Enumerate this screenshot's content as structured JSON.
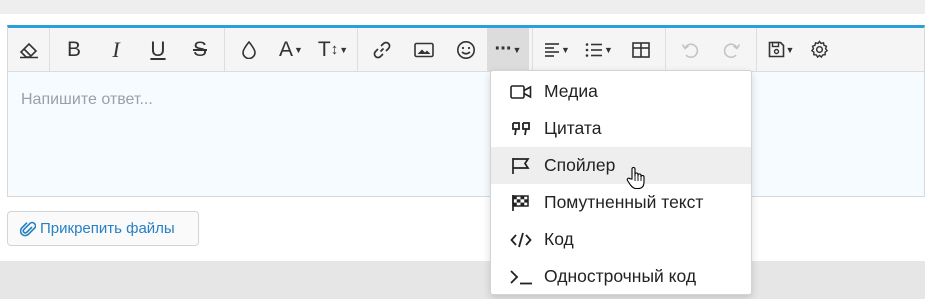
{
  "editor": {
    "placeholder": "Напишите ответ...",
    "accent_color": "#2b9fdc"
  },
  "toolbar": {
    "buttons": [
      {
        "name": "remove-format",
        "icon": "eraser-icon"
      },
      {
        "name": "bold",
        "label": "B"
      },
      {
        "name": "italic",
        "label": "I"
      },
      {
        "name": "underline",
        "label": "U"
      },
      {
        "name": "strikethrough",
        "label": "S"
      },
      {
        "name": "text-color",
        "icon": "droplet-icon"
      },
      {
        "name": "font-family",
        "label": "A"
      },
      {
        "name": "font-size",
        "label": "T↕"
      },
      {
        "name": "link",
        "icon": "link-icon"
      },
      {
        "name": "image",
        "icon": "image-icon"
      },
      {
        "name": "emoji",
        "icon": "smile-icon"
      },
      {
        "name": "more",
        "label": "···",
        "active": true
      },
      {
        "name": "align",
        "icon": "align-left-icon"
      },
      {
        "name": "list",
        "icon": "list-icon"
      },
      {
        "name": "table",
        "icon": "table-icon"
      },
      {
        "name": "undo",
        "icon": "undo-icon",
        "disabled": true
      },
      {
        "name": "redo",
        "icon": "redo-icon",
        "disabled": true
      },
      {
        "name": "drafts",
        "icon": "save-icon"
      },
      {
        "name": "settings",
        "icon": "gear-icon"
      }
    ]
  },
  "insert_menu": {
    "items": [
      {
        "label": "Медиа",
        "icon": "video-icon"
      },
      {
        "label": "Цитата",
        "icon": "quote-icon"
      },
      {
        "label": "Спойлер",
        "icon": "flag-icon",
        "hover": true
      },
      {
        "label": "Помутненный текст",
        "icon": "checkered-flag-icon"
      },
      {
        "label": "Код",
        "icon": "code-icon"
      },
      {
        "label": "Однострочный код",
        "icon": "terminal-icon"
      }
    ]
  },
  "attach": {
    "label": "Прикрепить файлы",
    "color": "#2581c4"
  },
  "toolbar_text": {
    "bold": "B",
    "italic": "I",
    "underline": "U",
    "strike": "S",
    "font": "A",
    "size": "T",
    "more": "···"
  }
}
